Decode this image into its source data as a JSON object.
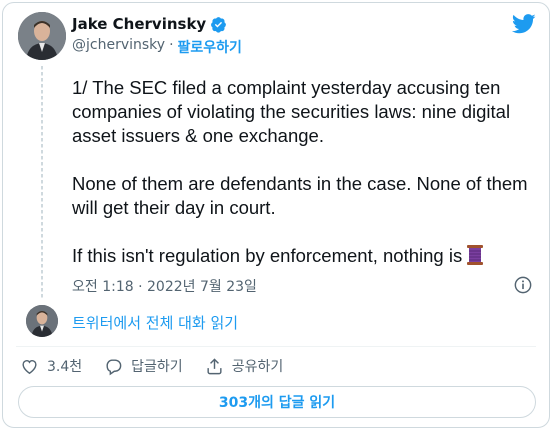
{
  "author": {
    "name": "Jake Chervinsky",
    "handle": "@jchervinsky",
    "separator": "·",
    "follow_label": "팔로우하기"
  },
  "tweet": {
    "paragraphs": [
      "1/ The SEC filed a complaint yesterday accusing ten companies of violating the securities laws: nine digital asset issuers & one exchange.",
      "None of them are defendants in the case. None of them will get their day in court.",
      "If this isn't regulation by enforcement, nothing is"
    ],
    "emoji": "spool-of-thread-icon",
    "timestamp": "오전 1:18 · 2022년 7월 23일"
  },
  "conversation": {
    "link_label": "트위터에서 전체 대화 읽기"
  },
  "actions": {
    "like_count": "3.4천",
    "reply_label": "답글하기",
    "share_label": "공유하기"
  },
  "replies_button": {
    "label": "303개의 답글 읽기"
  },
  "colors": {
    "accent": "#1d9bf0",
    "secondary_text": "#536471",
    "border": "#cfd9de",
    "spool": "#7b3fa0"
  }
}
